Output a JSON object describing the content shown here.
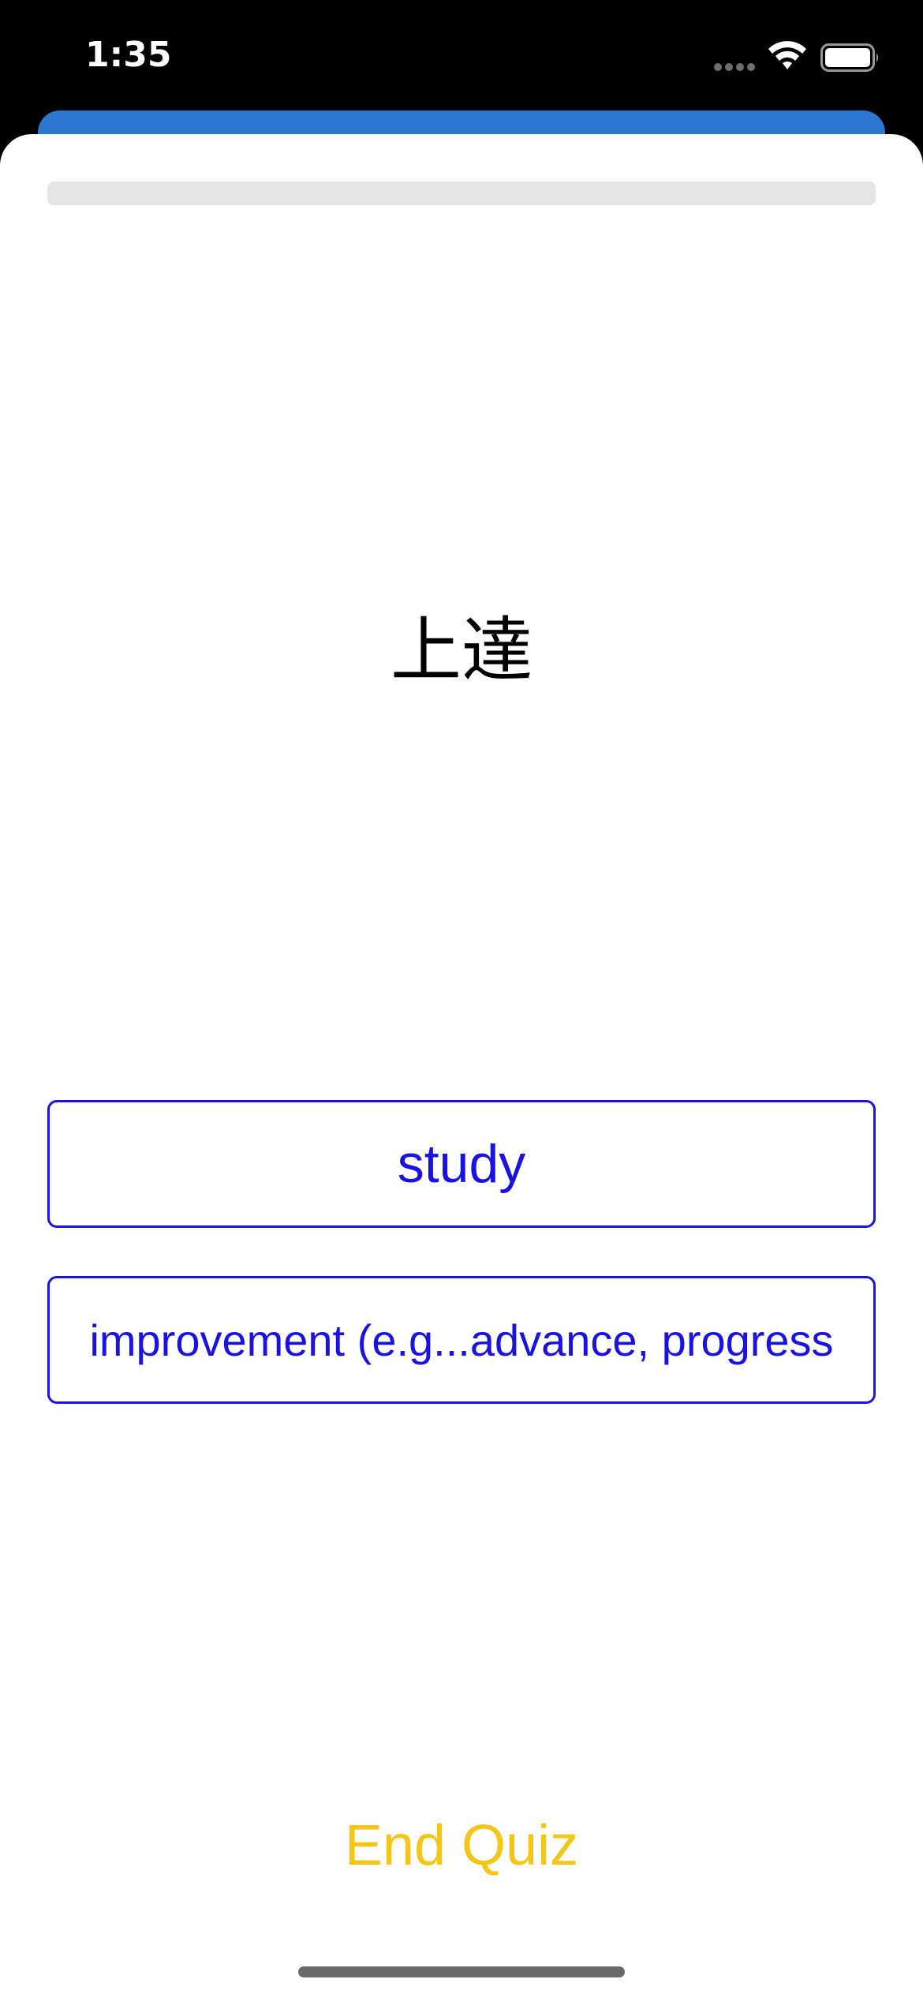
{
  "status_bar": {
    "time": "1:35",
    "wifi_icon": "wifi-icon",
    "battery_icon": "battery-icon",
    "signal_icon": "signal-dots-icon"
  },
  "quiz": {
    "progress_fraction": 0,
    "question": "上達",
    "answers": [
      {
        "label": "study"
      },
      {
        "label": "improvement (e.g...advance, progress"
      }
    ],
    "end_label": "End Quiz"
  },
  "colors": {
    "accent_blue": "#2a78d0",
    "answer_blue": "#1a12e0",
    "end_quiz_yellow": "#f5c518",
    "progress_track": "#e5e5e5"
  }
}
